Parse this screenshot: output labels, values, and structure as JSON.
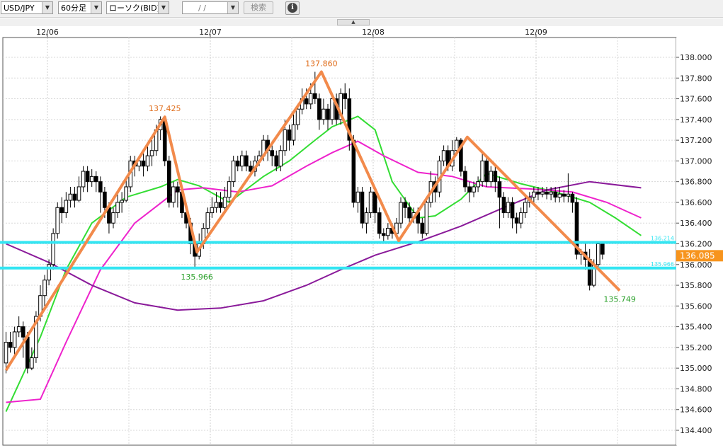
{
  "toolbar": {
    "symbol": "USD/JPY",
    "timeframe": "60分足",
    "chart_style": "ローソク(BID)",
    "date_input": "  /  /",
    "search_label": "検索"
  },
  "chart_data": {
    "type": "candlestick",
    "x_dates": [
      "12/06",
      "12/07",
      "12/08",
      "12/09"
    ],
    "ylim": [
      134.3,
      138.15
    ],
    "y_ticks": [
      "134.400",
      "134.600",
      "134.800",
      "135.000",
      "135.200",
      "135.400",
      "135.600",
      "135.800",
      "136.000",
      "136.200",
      "136.400",
      "136.600",
      "136.800",
      "137.000",
      "137.200",
      "137.400",
      "137.600",
      "137.800",
      "138.000"
    ],
    "grid": true,
    "current_price": "136.085",
    "horizontal_lines": [
      {
        "value": 136.214,
        "label": "136.214",
        "color": "#33e5f2"
      },
      {
        "value": 135.966,
        "label": "135.966",
        "color": "#33e5f2"
      }
    ],
    "zigzag": {
      "color": "#f28a4b",
      "points": [
        [
          0,
          134.98
        ],
        [
          37,
          137.425
        ],
        [
          44.5,
          136.12
        ],
        [
          73.5,
          137.86
        ],
        [
          91.5,
          136.23
        ],
        [
          107.5,
          137.23
        ],
        [
          143,
          135.749
        ]
      ]
    },
    "annotations": [
      {
        "text": "137.425",
        "value": 137.425,
        "color": "#e07020"
      },
      {
        "text": "135.966",
        "value": 135.966,
        "color": "#2aa02a"
      },
      {
        "text": "137.860",
        "value": 137.86,
        "color": "#e07020"
      },
      {
        "text": "135.749",
        "value": 135.749,
        "color": "#2aa02a"
      }
    ],
    "ma_series": [
      {
        "color": "#33dd33",
        "points": [
          [
            0,
            134.58
          ],
          [
            8,
            135.3
          ],
          [
            14,
            135.95
          ],
          [
            20,
            136.4
          ],
          [
            28,
            136.65
          ],
          [
            36,
            136.75
          ],
          [
            40,
            136.82
          ],
          [
            45,
            136.76
          ],
          [
            52,
            136.6
          ],
          [
            60,
            136.85
          ],
          [
            66,
            137.0
          ],
          [
            72,
            137.2
          ],
          [
            76,
            137.33
          ],
          [
            82,
            137.43
          ],
          [
            86,
            137.3
          ],
          [
            90,
            136.8
          ],
          [
            96,
            136.45
          ],
          [
            100,
            136.47
          ],
          [
            106,
            136.63
          ],
          [
            112,
            136.88
          ],
          [
            120,
            136.78
          ],
          [
            128,
            136.7
          ],
          [
            136,
            136.6
          ],
          [
            142,
            136.45
          ],
          [
            148,
            136.28
          ]
        ]
      },
      {
        "color": "#ee22cc",
        "points": [
          [
            0,
            134.67
          ],
          [
            8,
            134.7
          ],
          [
            14,
            135.25
          ],
          [
            22,
            135.95
          ],
          [
            30,
            136.4
          ],
          [
            40,
            136.72
          ],
          [
            46,
            136.74
          ],
          [
            54,
            136.7
          ],
          [
            62,
            136.76
          ],
          [
            70,
            136.95
          ],
          [
            76,
            137.08
          ],
          [
            82,
            137.19
          ],
          [
            88,
            137.05
          ],
          [
            96,
            136.89
          ],
          [
            104,
            136.85
          ],
          [
            112,
            136.75
          ],
          [
            122,
            136.73
          ],
          [
            132,
            136.7
          ],
          [
            140,
            136.6
          ],
          [
            148,
            136.45
          ]
        ]
      },
      {
        "color": "#8a1a9a",
        "points": [
          [
            0,
            136.2
          ],
          [
            10,
            136.02
          ],
          [
            20,
            135.8
          ],
          [
            30,
            135.63
          ],
          [
            40,
            135.56
          ],
          [
            50,
            135.58
          ],
          [
            60,
            135.65
          ],
          [
            70,
            135.8
          ],
          [
            78,
            135.95
          ],
          [
            86,
            136.09
          ],
          [
            96,
            136.22
          ],
          [
            106,
            136.37
          ],
          [
            116,
            136.55
          ],
          [
            126,
            136.72
          ],
          [
            136,
            136.8
          ],
          [
            148,
            136.74
          ]
        ]
      }
    ],
    "candles": [
      [
        135.05,
        135.25,
        135.35,
        134.95
      ],
      [
        135.25,
        135.2,
        135.35,
        135.15
      ],
      [
        135.2,
        135.35,
        135.4,
        135.1
      ],
      [
        135.35,
        135.4,
        135.5,
        135.3
      ],
      [
        135.4,
        135.3,
        135.45,
        135.1
      ],
      [
        135.3,
        135.0,
        135.35,
        134.95
      ],
      [
        135.0,
        135.1,
        135.2,
        134.98
      ],
      [
        135.1,
        135.5,
        135.55,
        135.05
      ],
      [
        135.5,
        135.7,
        135.8,
        135.45
      ],
      [
        135.7,
        135.85,
        135.9,
        135.6
      ],
      [
        135.85,
        136.0,
        136.05,
        135.8
      ],
      [
        136.0,
        136.3,
        136.35,
        135.95
      ],
      [
        136.3,
        136.55,
        136.6,
        136.25
      ],
      [
        136.55,
        136.5,
        136.65,
        136.4
      ],
      [
        136.5,
        136.62,
        136.7,
        136.45
      ],
      [
        136.62,
        136.68,
        136.75,
        136.55
      ],
      [
        136.68,
        136.62,
        136.75,
        136.55
      ],
      [
        136.62,
        136.75,
        136.85,
        136.6
      ],
      [
        136.75,
        136.9,
        136.95,
        136.7
      ],
      [
        136.9,
        136.8,
        136.95,
        136.7
      ],
      [
        136.8,
        136.85,
        136.92,
        136.75
      ],
      [
        136.85,
        136.8,
        136.9,
        136.7
      ],
      [
        136.8,
        136.7,
        136.85,
        136.5
      ],
      [
        136.7,
        136.55,
        136.75,
        136.45
      ],
      [
        136.55,
        136.4,
        136.6,
        136.3
      ],
      [
        136.4,
        136.5,
        136.55,
        136.35
      ],
      [
        136.5,
        136.6,
        136.7,
        136.45
      ],
      [
        136.6,
        136.62,
        136.7,
        136.5
      ],
      [
        136.62,
        136.75,
        136.85,
        136.6
      ],
      [
        136.75,
        137.0,
        137.05,
        136.7
      ],
      [
        137.0,
        136.95,
        137.05,
        136.85
      ],
      [
        136.95,
        137.0,
        137.05,
        136.9
      ],
      [
        137.0,
        136.95,
        137.1,
        136.85
      ],
      [
        136.95,
        137.05,
        137.15,
        136.9
      ],
      [
        137.05,
        137.1,
        137.2,
        136.95
      ],
      [
        137.1,
        137.3,
        137.35,
        137.05
      ],
      [
        137.3,
        137.4,
        137.43,
        137.2
      ],
      [
        137.4,
        137.0,
        137.42,
        136.95
      ],
      [
        137.0,
        136.6,
        137.05,
        136.55
      ],
      [
        136.6,
        136.75,
        136.8,
        136.55
      ],
      [
        136.75,
        136.7,
        136.8,
        136.55
      ],
      [
        136.7,
        136.5,
        136.75,
        136.45
      ],
      [
        136.5,
        136.4,
        136.55,
        136.35
      ],
      [
        136.4,
        136.2,
        136.45,
        136.1
      ],
      [
        136.2,
        136.08,
        136.25,
        135.97
      ],
      [
        136.08,
        136.2,
        136.3,
        136.05
      ],
      [
        136.2,
        136.35,
        136.4,
        136.15
      ],
      [
        136.35,
        136.5,
        136.55,
        136.3
      ],
      [
        136.5,
        136.55,
        136.65,
        136.45
      ],
      [
        136.55,
        136.6,
        136.7,
        136.5
      ],
      [
        136.6,
        136.55,
        136.7,
        136.5
      ],
      [
        136.55,
        136.65,
        136.75,
        136.5
      ],
      [
        136.65,
        136.8,
        136.85,
        136.6
      ],
      [
        136.8,
        137.0,
        137.05,
        136.75
      ],
      [
        137.0,
        136.95,
        137.05,
        136.9
      ],
      [
        136.95,
        137.05,
        137.1,
        136.9
      ],
      [
        137.05,
        136.95,
        137.1,
        136.9
      ],
      [
        136.95,
        136.9,
        137.0,
        136.85
      ],
      [
        136.9,
        137.0,
        137.05,
        136.85
      ],
      [
        137.0,
        137.05,
        137.1,
        136.95
      ],
      [
        137.05,
        137.2,
        137.25,
        137.0
      ],
      [
        137.2,
        137.1,
        137.25,
        137.0
      ],
      [
        137.1,
        137.05,
        137.15,
        136.95
      ],
      [
        137.05,
        136.95,
        137.1,
        136.9
      ],
      [
        136.95,
        137.1,
        137.15,
        136.9
      ],
      [
        137.1,
        137.3,
        137.4,
        137.05
      ],
      [
        137.3,
        137.2,
        137.35,
        137.1
      ],
      [
        137.2,
        137.35,
        137.45,
        137.15
      ],
      [
        137.35,
        137.5,
        137.55,
        137.3
      ],
      [
        137.5,
        137.6,
        137.7,
        137.45
      ],
      [
        137.6,
        137.55,
        137.7,
        137.5
      ],
      [
        137.55,
        137.65,
        137.75,
        137.5
      ],
      [
        137.65,
        137.6,
        137.86,
        137.55
      ],
      [
        137.6,
        137.4,
        137.65,
        137.3
      ],
      [
        137.4,
        137.5,
        137.6,
        137.35
      ],
      [
        137.5,
        137.4,
        137.55,
        137.3
      ],
      [
        137.4,
        137.6,
        137.65,
        137.35
      ],
      [
        137.6,
        137.4,
        137.65,
        137.35
      ],
      [
        137.4,
        137.65,
        137.7,
        137.35
      ],
      [
        137.65,
        137.6,
        137.75,
        137.5
      ],
      [
        137.6,
        137.2,
        137.7,
        137.1
      ],
      [
        137.2,
        136.6,
        137.25,
        136.55
      ],
      [
        136.6,
        136.7,
        136.75,
        136.5
      ],
      [
        136.7,
        136.4,
        136.75,
        136.35
      ],
      [
        136.4,
        136.5,
        136.55,
        136.3
      ],
      [
        136.5,
        136.7,
        136.75,
        136.45
      ],
      [
        136.7,
        136.5,
        136.75,
        136.4
      ],
      [
        136.5,
        136.3,
        136.55,
        136.25
      ],
      [
        136.3,
        136.28,
        136.35,
        136.22
      ],
      [
        136.28,
        136.35,
        136.4,
        136.24
      ],
      [
        136.35,
        136.3,
        136.4,
        136.25
      ],
      [
        136.3,
        136.4,
        136.45,
        136.25
      ],
      [
        136.4,
        136.6,
        136.65,
        136.35
      ],
      [
        136.6,
        136.55,
        136.65,
        136.45
      ],
      [
        136.55,
        136.45,
        136.6,
        136.4
      ],
      [
        136.45,
        136.5,
        136.55,
        136.4
      ],
      [
        136.5,
        136.4,
        136.55,
        136.3
      ],
      [
        136.4,
        136.3,
        136.45,
        136.25
      ],
      [
        136.3,
        136.6,
        136.65,
        136.28
      ],
      [
        136.6,
        136.8,
        136.9,
        136.55
      ],
      [
        136.8,
        136.7,
        136.85,
        136.6
      ],
      [
        136.7,
        137.0,
        137.05,
        136.65
      ],
      [
        137.0,
        137.1,
        137.15,
        136.95
      ],
      [
        137.1,
        136.95,
        137.15,
        136.9
      ],
      [
        136.95,
        137.1,
        137.2,
        136.9
      ],
      [
        137.1,
        137.2,
        137.23,
        137.05
      ],
      [
        137.2,
        136.9,
        137.22,
        136.85
      ],
      [
        136.9,
        136.75,
        136.95,
        136.7
      ],
      [
        136.75,
        136.7,
        136.8,
        136.6
      ],
      [
        136.7,
        136.75,
        136.8,
        136.65
      ],
      [
        136.75,
        136.8,
        136.85,
        136.7
      ],
      [
        136.8,
        137.0,
        137.1,
        136.75
      ],
      [
        137.0,
        136.8,
        137.05,
        136.75
      ],
      [
        136.8,
        136.9,
        136.95,
        136.75
      ],
      [
        136.9,
        136.8,
        136.95,
        136.7
      ],
      [
        136.8,
        136.65,
        136.85,
        136.35
      ],
      [
        136.65,
        136.5,
        136.7,
        136.45
      ],
      [
        136.5,
        136.6,
        136.65,
        136.45
      ],
      [
        136.6,
        136.45,
        136.65,
        136.35
      ],
      [
        136.45,
        136.4,
        136.5,
        136.3
      ],
      [
        136.4,
        136.5,
        136.55,
        136.35
      ],
      [
        136.5,
        136.6,
        136.65,
        136.45
      ],
      [
        136.6,
        136.65,
        136.7,
        136.55
      ],
      [
        136.65,
        136.7,
        136.75,
        136.6
      ],
      [
        136.7,
        136.68,
        136.75,
        136.62
      ],
      [
        136.68,
        136.7,
        136.75,
        136.65
      ],
      [
        136.7,
        136.68,
        136.75,
        136.63
      ],
      [
        136.68,
        136.7,
        136.75,
        136.62
      ],
      [
        136.7,
        136.65,
        136.75,
        136.6
      ],
      [
        136.65,
        136.68,
        136.75,
        136.6
      ],
      [
        136.68,
        136.66,
        136.72,
        136.6
      ],
      [
        136.66,
        136.68,
        136.88,
        136.6
      ],
      [
        136.68,
        136.6,
        136.7,
        136.5
      ],
      [
        136.6,
        136.1,
        136.65,
        136.05
      ],
      [
        136.1,
        136.12,
        136.15,
        136.0
      ],
      [
        136.12,
        136.05,
        136.2,
        135.95
      ],
      [
        136.05,
        135.8,
        136.15,
        135.75
      ],
      [
        135.8,
        136.0,
        136.05,
        135.78
      ],
      [
        136.0,
        136.2,
        136.22,
        135.95
      ],
      [
        136.2,
        136.1,
        136.22,
        136.05
      ]
    ]
  }
}
